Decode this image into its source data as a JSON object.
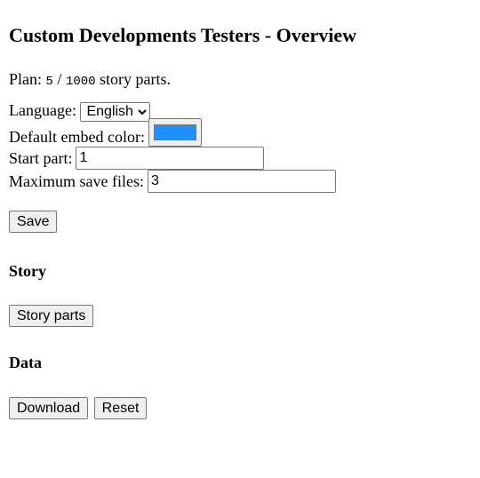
{
  "page": {
    "title": "Custom Developments Testers - Overview"
  },
  "plan": {
    "label": "Plan:",
    "used": "5",
    "separator": "/",
    "limit": "1000",
    "suffix": "story parts."
  },
  "settings": {
    "language_label": "Language:",
    "language_value": "English",
    "embed_color_label": "Default embed color:",
    "embed_color_value": "#1e90ff",
    "start_part_label": "Start part:",
    "start_part_value": "1",
    "max_save_label": "Maximum save files:",
    "max_save_value": "3",
    "save_button": "Save"
  },
  "story": {
    "heading": "Story",
    "story_parts_button": "Story parts"
  },
  "data_section": {
    "heading": "Data",
    "download_button": "Download",
    "reset_button": "Reset"
  }
}
